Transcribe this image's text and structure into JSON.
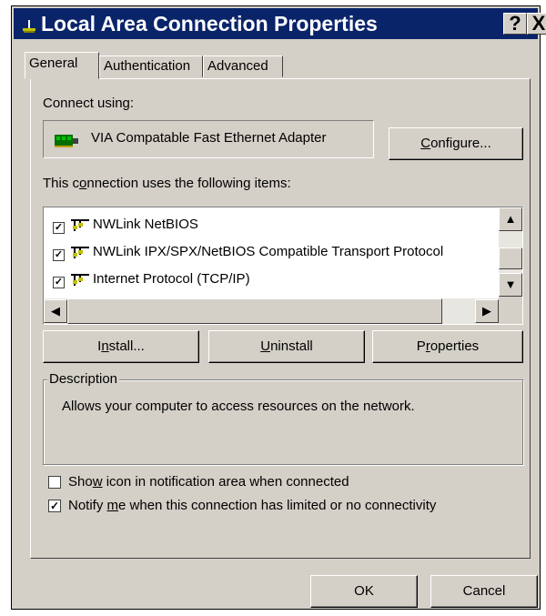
{
  "window": {
    "title": "Local Area Connection Properties",
    "help_label": "?",
    "close_label": "X"
  },
  "tabs": [
    {
      "label": "General",
      "active": true
    },
    {
      "label": "Authentication",
      "active": false
    },
    {
      "label": "Advanced",
      "active": false
    }
  ],
  "connect": {
    "label": "Connect using:",
    "adapter": "VIA Compatable Fast Ethernet Adapter",
    "configure_label_pre": "",
    "configure_label_u": "C",
    "configure_label_post": "onfigure..."
  },
  "items_section": {
    "label_pre": "This c",
    "label_u": "o",
    "label_post": "nnection uses the following items:",
    "items": [
      {
        "label": "NWLink NetBIOS",
        "checked": true
      },
      {
        "label": "NWLink IPX/SPX/NetBIOS Compatible Transport Protocol",
        "checked": true
      },
      {
        "label": "Internet Protocol (TCP/IP)",
        "checked": true
      }
    ],
    "scroll_up": "▲",
    "scroll_down": "▼",
    "scroll_left": "◀",
    "scroll_right": "▶"
  },
  "buttons": {
    "install_pre": "I",
    "install_u": "n",
    "install_post": "stall...",
    "uninstall_pre": "",
    "uninstall_u": "U",
    "uninstall_post": "ninstall",
    "properties_pre": "P",
    "properties_u": "r",
    "properties_post": "operties",
    "ok": "OK",
    "cancel": "Cancel"
  },
  "description": {
    "legend": "Description",
    "text": "Allows your computer to access resources on the network."
  },
  "options": {
    "show_icon_pre": "Sho",
    "show_icon_u": "w",
    "show_icon_post": " icon in notification area when connected",
    "show_icon_checked": false,
    "notify_pre": "Notify ",
    "notify_u": "m",
    "notify_post": "e when this connection has limited or no connectivity",
    "notify_checked": true,
    "check_mark": "✓"
  },
  "colors": {
    "titlebar": "#0a246a",
    "face": "#d4d0c8"
  }
}
